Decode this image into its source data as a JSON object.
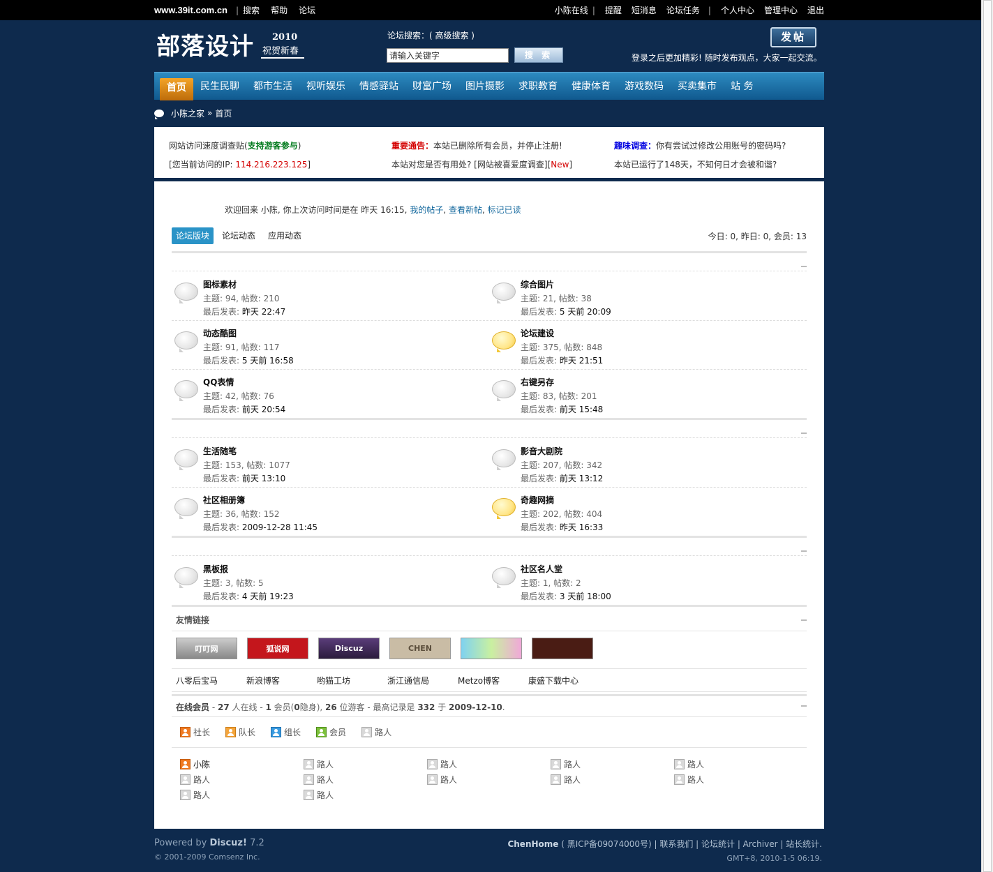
{
  "topbar": {
    "site": "www.39it.com.cn",
    "left_links": [
      "搜索",
      "帮助",
      "论坛"
    ],
    "right_links": [
      "小陈在线",
      "提醒",
      "短消息",
      "论坛任务",
      "个人中心",
      "管理中心",
      "退出"
    ]
  },
  "header": {
    "logo_text": "部落设计",
    "logo_year": "2010",
    "logo_sub": "祝贺新春",
    "search_label": "论坛搜索：( 高级搜索 )",
    "search_placeholder": "请输入关键字",
    "search_button": "搜 索",
    "post_button": "发帖",
    "slogan": "登录之后更加精彩! 随时发布观点，大家一起交流。"
  },
  "nav": {
    "items": [
      "首页",
      "民生民聊",
      "都市生活",
      "视听娱乐",
      "情感驿站",
      "财富广场",
      "图片摄影",
      "求职教育",
      "健康体育",
      "游戏数码",
      "买卖集市",
      "站 务"
    ],
    "active_index": 0
  },
  "breadcrumb": {
    "home": "小陈之家",
    "arrow": "»",
    "current": "首页"
  },
  "announce": {
    "col1": {
      "line1_pre": "网站访问速度调查贴(",
      "line1_link": "支持游客参与",
      "line1_post": ")",
      "line2_pre": "[您当前访问的IP: ",
      "line2_ip": "114.216.223.125",
      "line2_post": "]"
    },
    "col2": {
      "line1_label": "重要通告：",
      "line1_text": "本站已删除所有会员，并停止注册!",
      "line2_pre": "本站对您是否有用处? [网站被喜爱度调查][",
      "line2_new": "New",
      "line2_post": "]"
    },
    "col3": {
      "line1_label": "趣味调查：",
      "line1_text": "你有尝试过修改公用账号的密码吗?",
      "line2": "本站已运行了148天，不知何日才会被和谐?"
    }
  },
  "welcome": {
    "text": "欢迎回来 小陈, 你上次访问时间是在 昨天 16:15,",
    "link1": "我的帖子",
    "link2": "查看新帖",
    "link3": "标记已读"
  },
  "tabs": [
    "论坛版块",
    "论坛动态",
    "应用动态"
  ],
  "stats": "今日: 0, 昨日: 0, 会员: 13",
  "last_label": "最后发表:",
  "forums": [
    {
      "name": "图标素材",
      "counts": "主题: 94, 帖数: 210",
      "last": "昨天 22:47",
      "new": false
    },
    {
      "name": "综合图片",
      "counts": "主题: 21, 帖数: 38",
      "last": "5 天前 20:09",
      "new": false
    },
    {
      "name": "动态酷图",
      "counts": "主题: 91, 帖数: 117",
      "last": "5 天前 16:58",
      "new": false
    },
    {
      "name": "论坛建设",
      "counts": "主题: 375, 帖数: 848",
      "last": "昨天 21:51",
      "new": true
    },
    {
      "name": "QQ表情",
      "counts": "主题: 42, 帖数: 76",
      "last": "前天 20:54",
      "new": false
    },
    {
      "name": "右键另存",
      "counts": "主题: 83, 帖数: 201",
      "last": "前天 15:48",
      "new": false
    },
    {
      "name": "生活随笔",
      "counts": "主题: 153, 帖数: 1077",
      "last": "前天 13:10",
      "new": false
    },
    {
      "name": "影音大剧院",
      "counts": "主题: 207, 帖数: 342",
      "last": "前天 13:12",
      "new": false
    },
    {
      "name": "社区相册簿",
      "counts": "主题: 36, 帖数: 152",
      "last": "2009-12-28 11:45",
      "new": false
    },
    {
      "name": "奇趣网摘",
      "counts": "主题: 202, 帖数: 404",
      "last": "昨天 16:33",
      "new": true
    },
    {
      "name": "黑板报",
      "counts": "主题: 3, 帖数: 5",
      "last": "4 天前 19:23",
      "new": false
    },
    {
      "name": "社区名人堂",
      "counts": "主题: 1, 帖数: 2",
      "last": "3 天前 18:00",
      "new": false
    }
  ],
  "links": {
    "title": "友情链接",
    "logos": [
      "叮叮网",
      "狐说网",
      "Discuz",
      "CHEN",
      "",
      ""
    ],
    "text": [
      "八零后宝马",
      "新浪博客",
      "哟猫工坊",
      "浙江通信局",
      "Metzo博客",
      "康盛下载中心"
    ]
  },
  "online": {
    "title": "在线会员",
    "s1": "- ",
    "total": "27",
    "s2": " 人在线 - ",
    "members": "1",
    "s3": " 会员(",
    "hidden": "0",
    "s4": "隐身), ",
    "guests": "26",
    "s5": " 位游客 - 最高记录是 ",
    "record": "332",
    "s6": " 于 ",
    "record_date": "2009-12-10",
    "s7": ".",
    "legend": [
      "社长",
      "队长",
      "组长",
      "会员",
      "路人"
    ],
    "list": [
      "小陈",
      "路人",
      "路人",
      "路人",
      "路人",
      "路人",
      "路人",
      "路人",
      "路人",
      "路人",
      "路人",
      "路人"
    ]
  },
  "footer": {
    "powered_pre": "Powered by ",
    "powered_name": "Discuz!",
    "powered_ver": " 7.2",
    "copyright": "© 2001-2009 Comsenz Inc.",
    "site": "ChenHome",
    "icp": "( 黑ICP备09074000号) | 联系我们  | 论坛统计 | Archiver | 站长统计.",
    "time": "GMT+8, 2010-1-5 06:19."
  },
  "colors": {
    "page_bg": "#0e2a4d",
    "nav": "#1a6ea6",
    "nav_active": "#e08a1a",
    "tab_active": "#2a93c7"
  }
}
